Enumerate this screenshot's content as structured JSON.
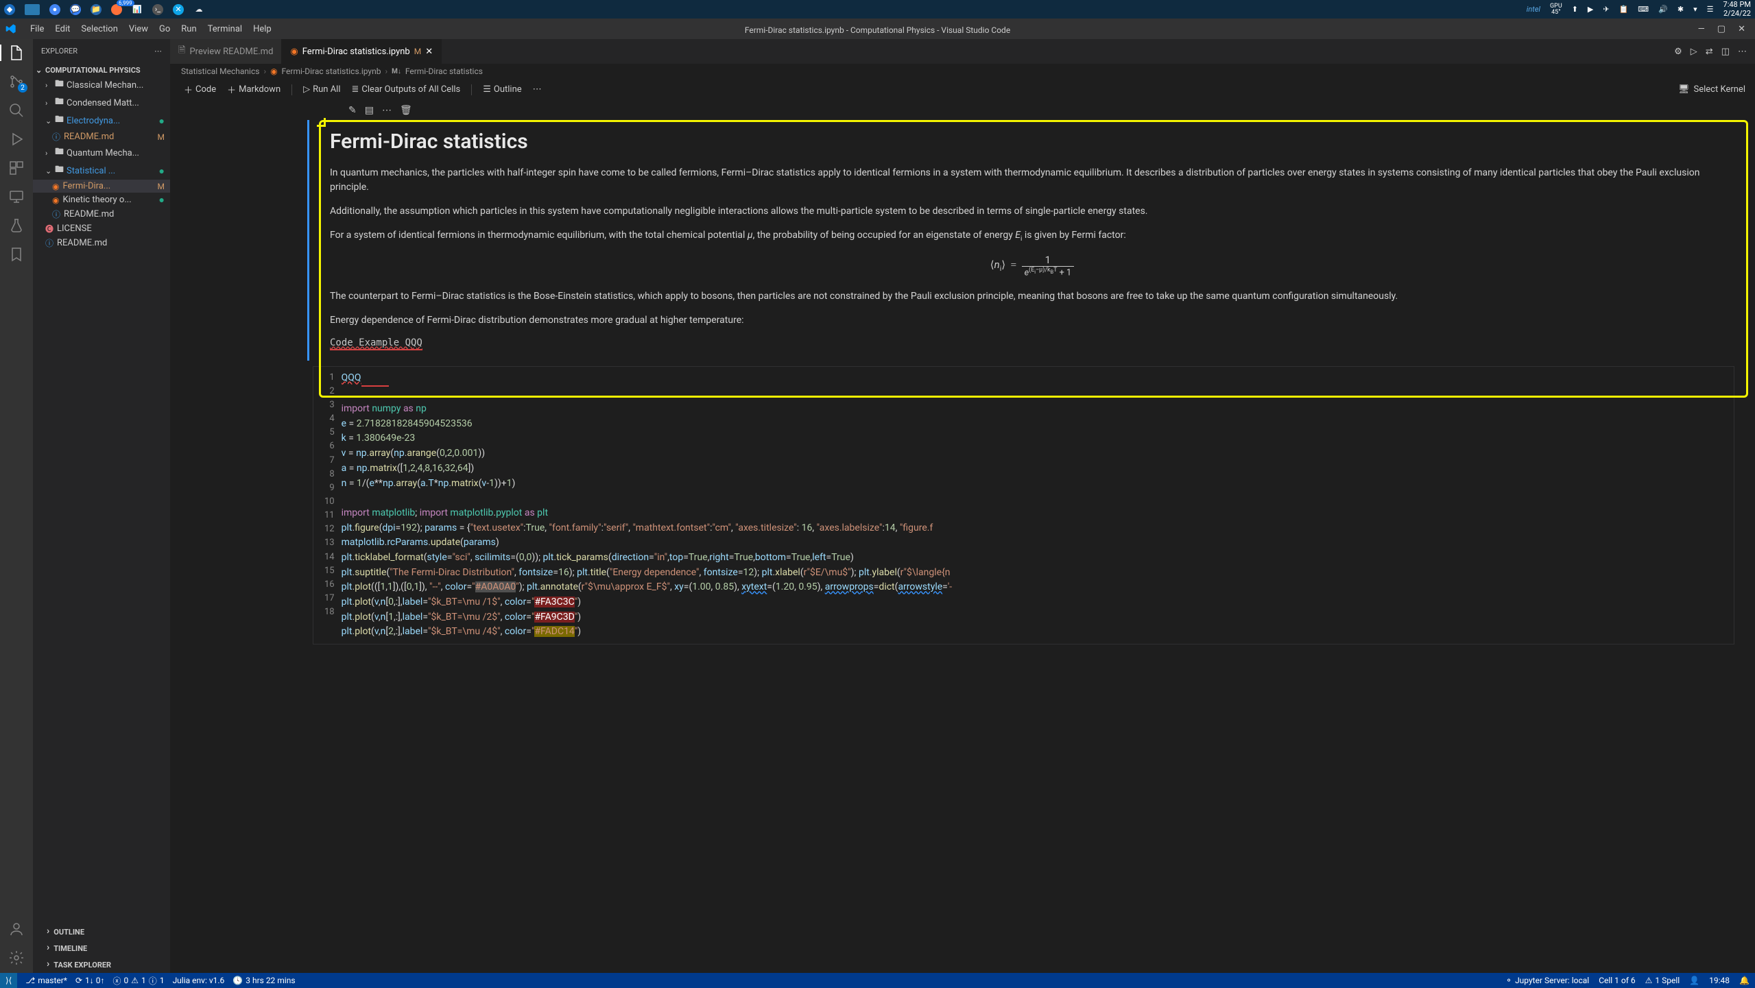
{
  "taskbar": {
    "gpu_label": "GPU",
    "gpu_temp": "45°",
    "intel": "intel",
    "time": "7:48 PM",
    "date": "2/24/22",
    "ff_badge": "6,999"
  },
  "menubar": {
    "items": [
      "File",
      "Edit",
      "Selection",
      "View",
      "Go",
      "Run",
      "Terminal",
      "Help"
    ],
    "title": "Fermi-Dirac statistics.ipynb - Computational Physics - Visual Studio Code"
  },
  "sidebar": {
    "title": "EXPLORER",
    "project": "COMPUTATIONAL PHYSICS",
    "tree": {
      "f0": "Classical Mechan...",
      "f1": "Condensed Matt...",
      "f2": "Electrodyna...",
      "f2a": "README.md",
      "f3": "Quantum Mecha...",
      "f4": "Statistical ...",
      "f4a": "Fermi-Dira...",
      "f4b": "Kinetic theory o...",
      "f4c": "README.md",
      "f5": "LICENSE",
      "f6": "README.md"
    },
    "footer": [
      "OUTLINE",
      "TIMELINE",
      "TASK EXPLORER"
    ]
  },
  "tabs": {
    "t0": "Preview README.md",
    "t1": "Fermi-Dirac statistics.ipynb",
    "t1_mod": "M"
  },
  "breadcrumbs": {
    "b0": "Statistical Mechanics",
    "b1": "Fermi-Dirac statistics.ipynb",
    "b2_pre": "M↓",
    "b2": "Fermi-Dirac statistics"
  },
  "nb_toolbar": {
    "code": "Code",
    "markdown": "Markdown",
    "run_all": "Run All",
    "clear": "Clear Outputs of All Cells",
    "outline": "Outline",
    "kernel": "Select Kernel"
  },
  "md": {
    "h1": "Fermi-Dirac statistics",
    "p1": "In quantum mechanics, the particles with half-integer spin have come to be called fermions, Fermi–Dirac statistics apply to identical fermions in a system with thermodynamic equilibrium. It describes a distribution of particles over energy states in systems consisting of many identical particles that obey the Pauli exclusion principle.",
    "p2": "Additionally, the assumption which particles in this system have computationally negligible interactions allows the multi-particle system to be described in terms of single-particle energy states.",
    "p3a": "For a system of identical fermions in thermodynamic equilibrium, with the total chemical potential ",
    "p3b": ", the probability of being occupied for an eigenstate of energy ",
    "p3c": " is given by Fermi factor:",
    "p4": "The counterpart to Fermi–Dirac statistics is the Bose-Einstein statistics, which apply to bosons, then particles are not constrained by the Pauli exclusion principle, meaning that bosons are free to take up the same quantum configuration simultaneously.",
    "p5": "Energy dependence of Fermi-Dirac distribution demonstrates more gradual at higher temperature:",
    "code_link": "Code Example QQQ"
  },
  "code": {
    "lines": [
      "1",
      "2",
      "3",
      "4",
      "5",
      "6",
      "7",
      "8",
      "9",
      "10",
      "11",
      "12",
      "13",
      "14",
      "15",
      "16",
      "17",
      "18"
    ]
  },
  "statusbar": {
    "branch": "master*",
    "sync": "1↓ 0↑",
    "problems": "0",
    "warnings": "1",
    "info": "1",
    "julia": "Julia env: v1.6",
    "time_spent": "3 hrs 22 mins",
    "jupyter": "Jupyter Server: local",
    "cell": "Cell 1 of 6",
    "spell": "1 Spell",
    "clock": "19:48"
  }
}
